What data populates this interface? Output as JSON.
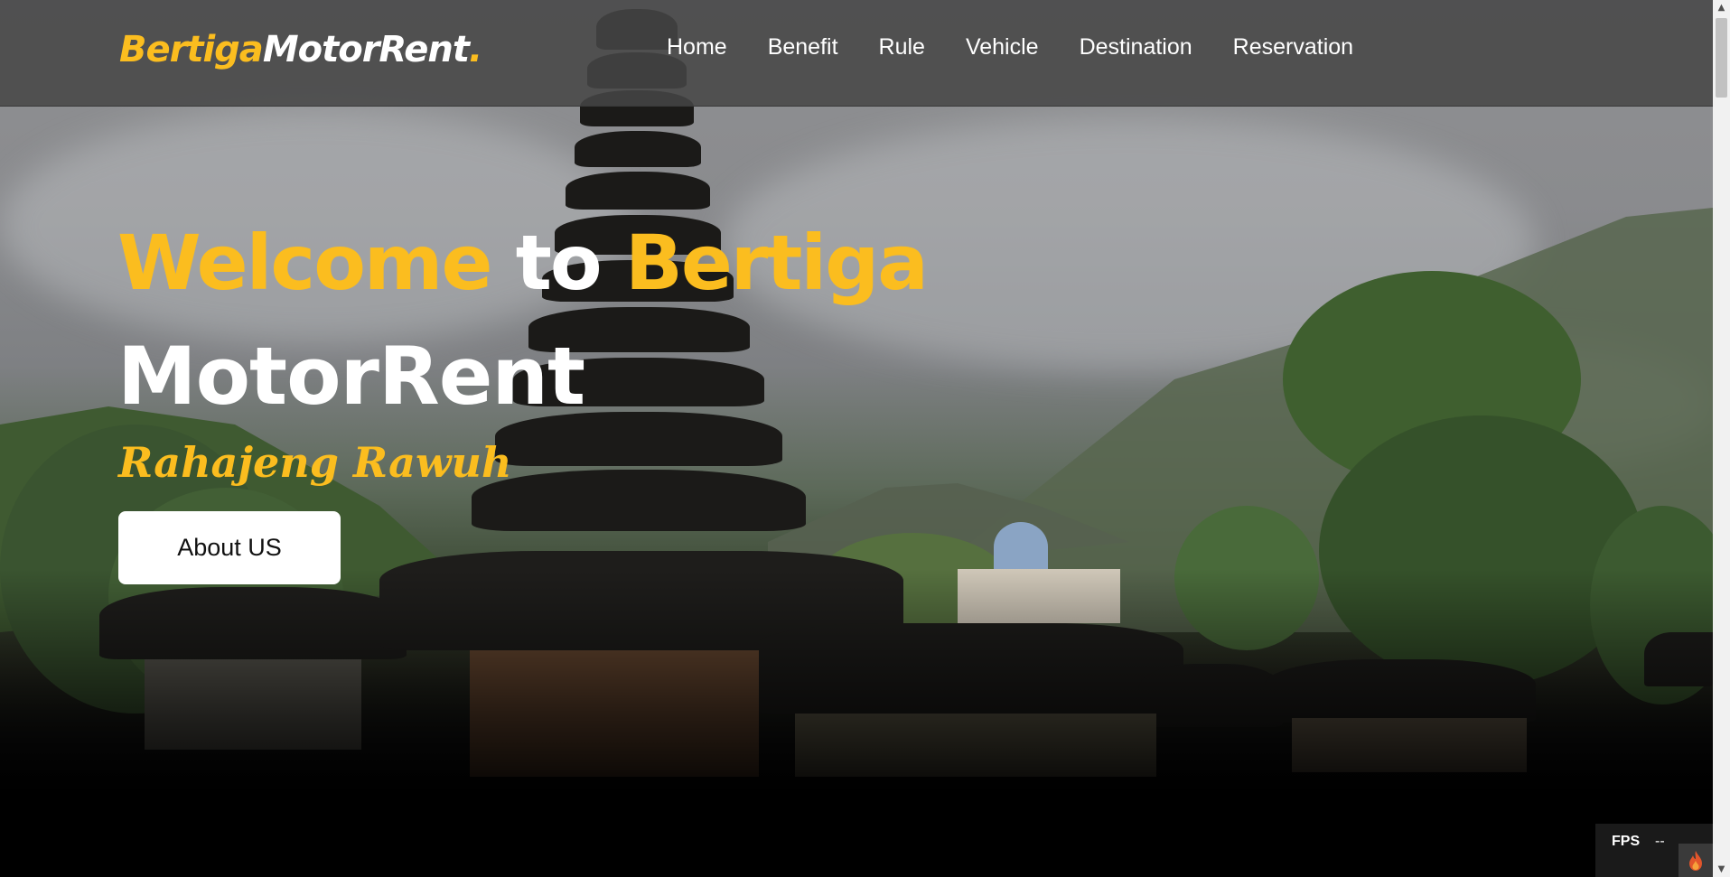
{
  "brand": {
    "part1": "Bertiga",
    "part2": "MotorRent",
    "dot": "."
  },
  "nav": {
    "items": [
      "Home",
      "Benefit",
      "Rule",
      "Vehicle",
      "Destination",
      "Reservation"
    ]
  },
  "hero": {
    "welcome": "Welcome",
    "to": "to",
    "bertiga": "Bertiga",
    "motorrent": "MotorRent",
    "subtitle": "Rahajeng Rawuh",
    "button": "About US"
  },
  "fps": {
    "label": "FPS",
    "value": "--",
    "icon": "flame-icon"
  },
  "colors": {
    "accent": "#fbbd1f",
    "navbar": "#464646",
    "button_bg": "#ffffff"
  }
}
